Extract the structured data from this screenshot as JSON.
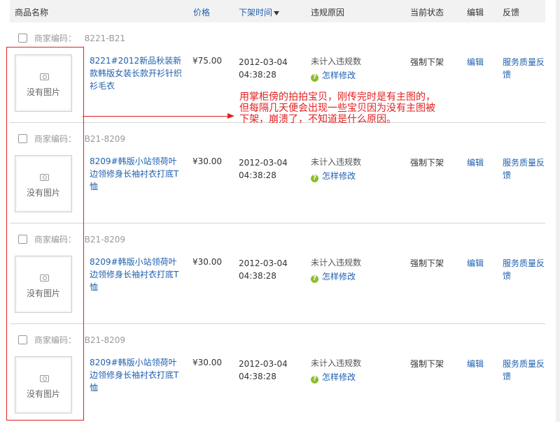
{
  "header": {
    "product_name": "商品名称",
    "price": "价格",
    "offshelf_time": "下架时间",
    "violation_reason": "违规原因",
    "current_status": "当前状态",
    "edit": "编辑",
    "feedback": "反馈"
  },
  "rows": [
    {
      "code_label": "商家编码：",
      "code": "8221-B21",
      "no_image": "没有图片",
      "title": "8221#2012新品秋装新款韩版女装长款开衫针织衫毛衣",
      "price": "¥75.00",
      "date": "2012-03-04",
      "time": "04:38:28",
      "reason": "未计入违规数",
      "how_to_fix": "怎样修改",
      "status": "强制下架",
      "edit": "编辑",
      "feedback": "服务质量反馈"
    },
    {
      "code_label": "商家编码：",
      "code": "B21-8209",
      "no_image": "没有图片",
      "title": "8209#韩版小站领荷叶边领修身长袖衬衣打底T恤",
      "price": "¥30.00",
      "date": "2012-03-04",
      "time": "04:38:28",
      "reason": "未计入违规数",
      "how_to_fix": "怎样修改",
      "status": "强制下架",
      "edit": "编辑",
      "feedback": "服务质量反馈"
    },
    {
      "code_label": "商家编码：",
      "code": "B21-8209",
      "no_image": "没有图片",
      "title": "8209#韩版小站领荷叶边领修身长袖衬衣打底T恤",
      "price": "¥30.00",
      "date": "2012-03-04",
      "time": "04:38:28",
      "reason": "未计入违规数",
      "how_to_fix": "怎样修改",
      "status": "强制下架",
      "edit": "编辑",
      "feedback": "服务质量反馈"
    },
    {
      "code_label": "商家编码：",
      "code": "B21-8209",
      "no_image": "没有图片",
      "title": "8209#韩版小站领荷叶边领修身长袖衬衣打底T恤",
      "price": "¥30.00",
      "date": "2012-03-04",
      "time": "04:38:28",
      "reason": "未计入违规数",
      "how_to_fix": "怎样修改",
      "status": "强制下架",
      "edit": "编辑",
      "feedback": "服务质量反馈"
    }
  ],
  "annotation": "用掌柜傍的拍拍宝贝，刚传完时是有主图的，但每隔几天便会出现一些宝贝因为没有主图被下架，崩溃了，不知道是什么原因。",
  "colors": {
    "link": "#2060b0",
    "annotation": "#e02020",
    "help_icon": "#8bbd2c"
  },
  "icons": [
    "camera-icon",
    "question-icon",
    "sort-down-icon",
    "checkbox"
  ]
}
